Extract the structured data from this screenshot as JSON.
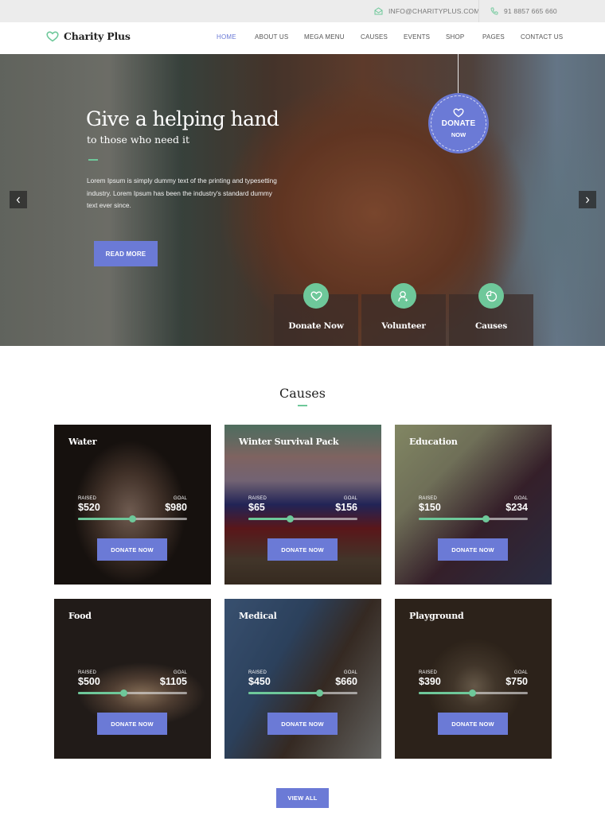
{
  "topbar": {
    "email": "INFO@CHARITYPLUS.COM",
    "email_icon": "envelope-open-icon",
    "phone": "91 8857 665 660",
    "phone_icon": "phone-icon"
  },
  "brand": {
    "name": "Charity Plus",
    "logo_icon": "heart-icon"
  },
  "nav": {
    "items": [
      {
        "label": "HOME",
        "active": true
      },
      {
        "label": "ABOUT US",
        "active": false
      },
      {
        "label": "MEGA MENU",
        "active": false
      },
      {
        "label": "CAUSES",
        "active": false
      },
      {
        "label": "EVENTS",
        "active": false
      },
      {
        "label": "SHOP",
        "active": false
      },
      {
        "label": "PAGES",
        "active": false
      },
      {
        "label": "CONTACT US",
        "active": false
      }
    ]
  },
  "hero": {
    "title": "Give a helping hand",
    "subtitle": "to those who need it",
    "text": "Lorem Ipsum is simply dummy text of the printing and typesetting industry. Lorem Ipsum has been the industry's standard dummy text ever since.",
    "read_more": "READ MORE",
    "prev_icon": "chevron-left-icon",
    "next_icon": "chevron-right-icon",
    "donate_badge": {
      "line1": "DONATE",
      "line2": "NOW",
      "icon": "heart-icon"
    },
    "features": [
      {
        "label": "Donate Now",
        "icon": "heart-icon"
      },
      {
        "label": "Volunteer",
        "icon": "user-plus-icon"
      },
      {
        "label": "Causes",
        "icon": "pie-chart-icon"
      }
    ]
  },
  "causes": {
    "title": "Causes",
    "raised_label": "RAISED",
    "goal_label": "GOAL",
    "button_label": "DONATE NOW",
    "items": [
      {
        "title": "Water",
        "raised": "$520",
        "goal": "$980",
        "progress": 0.5
      },
      {
        "title": "Winter Survival Pack",
        "raised": "$65",
        "goal": "$156",
        "progress": 0.38
      },
      {
        "title": "Education",
        "raised": "$150",
        "goal": "$234",
        "progress": 0.62
      },
      {
        "title": "Food",
        "raised": "$500",
        "goal": "$1105",
        "progress": 0.42
      },
      {
        "title": "Medical",
        "raised": "$450",
        "goal": "$660",
        "progress": 0.65
      },
      {
        "title": "Playground",
        "raised": "$390",
        "goal": "$750",
        "progress": 0.49
      }
    ],
    "view_all": "VIEW ALL"
  },
  "colors": {
    "accent": "#6b7ad6",
    "green": "#6ec89a",
    "topbar_bg": "#ececec"
  }
}
